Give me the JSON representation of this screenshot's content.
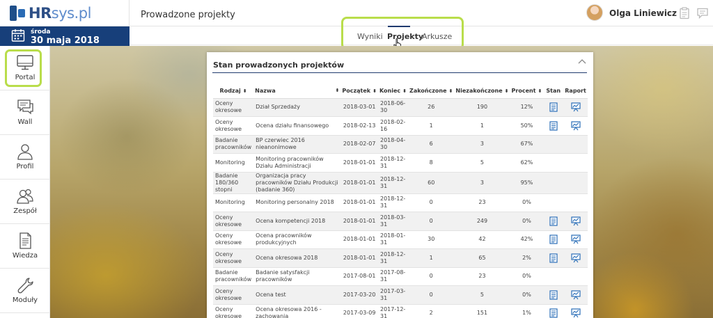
{
  "app": {
    "logo_main": "HR",
    "logo_rest": "sys.pl",
    "page_title": "Prowadzone projekty",
    "user_name": "Olga Liniewicz"
  },
  "date": {
    "weekday": "środa",
    "full": "30 maja 2018"
  },
  "tabs": [
    {
      "label": "Wyniki"
    },
    {
      "label": "Projekty"
    },
    {
      "label": "Arkusze"
    }
  ],
  "sidebar": {
    "items": [
      {
        "label": "Portal",
        "icon": "monitor-icon"
      },
      {
        "label": "Wall",
        "icon": "chat-icon"
      },
      {
        "label": "Profil",
        "icon": "user-icon"
      },
      {
        "label": "Zespół",
        "icon": "team-icon"
      },
      {
        "label": "Wiedza",
        "icon": "document-icon"
      },
      {
        "label": "Moduły",
        "icon": "wrench-icon"
      }
    ]
  },
  "card": {
    "title": "Stan prowadzonych projektów"
  },
  "table": {
    "headers": [
      "Rodzaj",
      "Nazwa",
      "Początek",
      "Koniec",
      "Zakończone",
      "Niezakończone",
      "Procent",
      "Stan",
      "Raport"
    ],
    "rows": [
      {
        "type": "Oceny okresowe",
        "name": "Dział Sprzedaży",
        "start": "2018-03-01",
        "end": "2018-06-30",
        "done": "26",
        "undone": "190",
        "pct": "12%",
        "stan": true,
        "raport": true
      },
      {
        "type": "Oceny okresowe",
        "name": "Ocena działu finansowego",
        "start": "2018-02-13",
        "end": "2018-02-16",
        "done": "1",
        "undone": "1",
        "pct": "50%",
        "stan": true,
        "raport": true
      },
      {
        "type": "Badanie pracowników",
        "name": "BP czerwiec 2016 nieanonimowe",
        "start": "2018-02-07",
        "end": "2018-04-30",
        "done": "6",
        "undone": "3",
        "pct": "67%",
        "stan": false,
        "raport": false
      },
      {
        "type": "Monitoring",
        "name": "Monitoring pracowników Działu Administracji",
        "start": "2018-01-01",
        "end": "2018-12-31",
        "done": "8",
        "undone": "5",
        "pct": "62%",
        "stan": false,
        "raport": false
      },
      {
        "type": "Badanie 180/360 stopni",
        "name": "Organizacja pracy pracowników Działu Produkcji (badanie 360)",
        "start": "2018-01-01",
        "end": "2018-12-31",
        "done": "60",
        "undone": "3",
        "pct": "95%",
        "stan": false,
        "raport": false
      },
      {
        "type": "Monitoring",
        "name": "Monitoring personalny 2018",
        "start": "2018-01-01",
        "end": "2018-12-31",
        "done": "0",
        "undone": "23",
        "pct": "0%",
        "stan": false,
        "raport": false
      },
      {
        "type": "Oceny okresowe",
        "name": "Ocena kompetencji 2018",
        "start": "2018-01-01",
        "end": "2018-03-31",
        "done": "0",
        "undone": "249",
        "pct": "0%",
        "stan": true,
        "raport": true
      },
      {
        "type": "Oceny okresowe",
        "name": "Ocena pracowników produkcyjnych",
        "start": "2018-01-01",
        "end": "2018-01-31",
        "done": "30",
        "undone": "42",
        "pct": "42%",
        "stan": true,
        "raport": true
      },
      {
        "type": "Oceny okresowe",
        "name": "Ocena okresowa 2018",
        "start": "2018-01-01",
        "end": "2018-12-31",
        "done": "1",
        "undone": "65",
        "pct": "2%",
        "stan": true,
        "raport": true
      },
      {
        "type": "Badanie pracowników",
        "name": "Badanie satysfakcji pracowników",
        "start": "2017-08-01",
        "end": "2017-08-31",
        "done": "0",
        "undone": "23",
        "pct": "0%",
        "stan": false,
        "raport": false
      },
      {
        "type": "Oceny okresowe",
        "name": "Ocena test",
        "start": "2017-03-20",
        "end": "2017-03-31",
        "done": "0",
        "undone": "5",
        "pct": "0%",
        "stan": true,
        "raport": true
      },
      {
        "type": "Oceny okresowe",
        "name": "Ocena okresowa 2016 - zachowania",
        "start": "2017-03-09",
        "end": "2017-12-31",
        "done": "2",
        "undone": "151",
        "pct": "1%",
        "stan": true,
        "raport": true
      }
    ]
  },
  "colors": {
    "brand_navy": "#173f7a",
    "highlight_green": "#b9dd4b",
    "icon_blue": "#2b6fb8"
  }
}
